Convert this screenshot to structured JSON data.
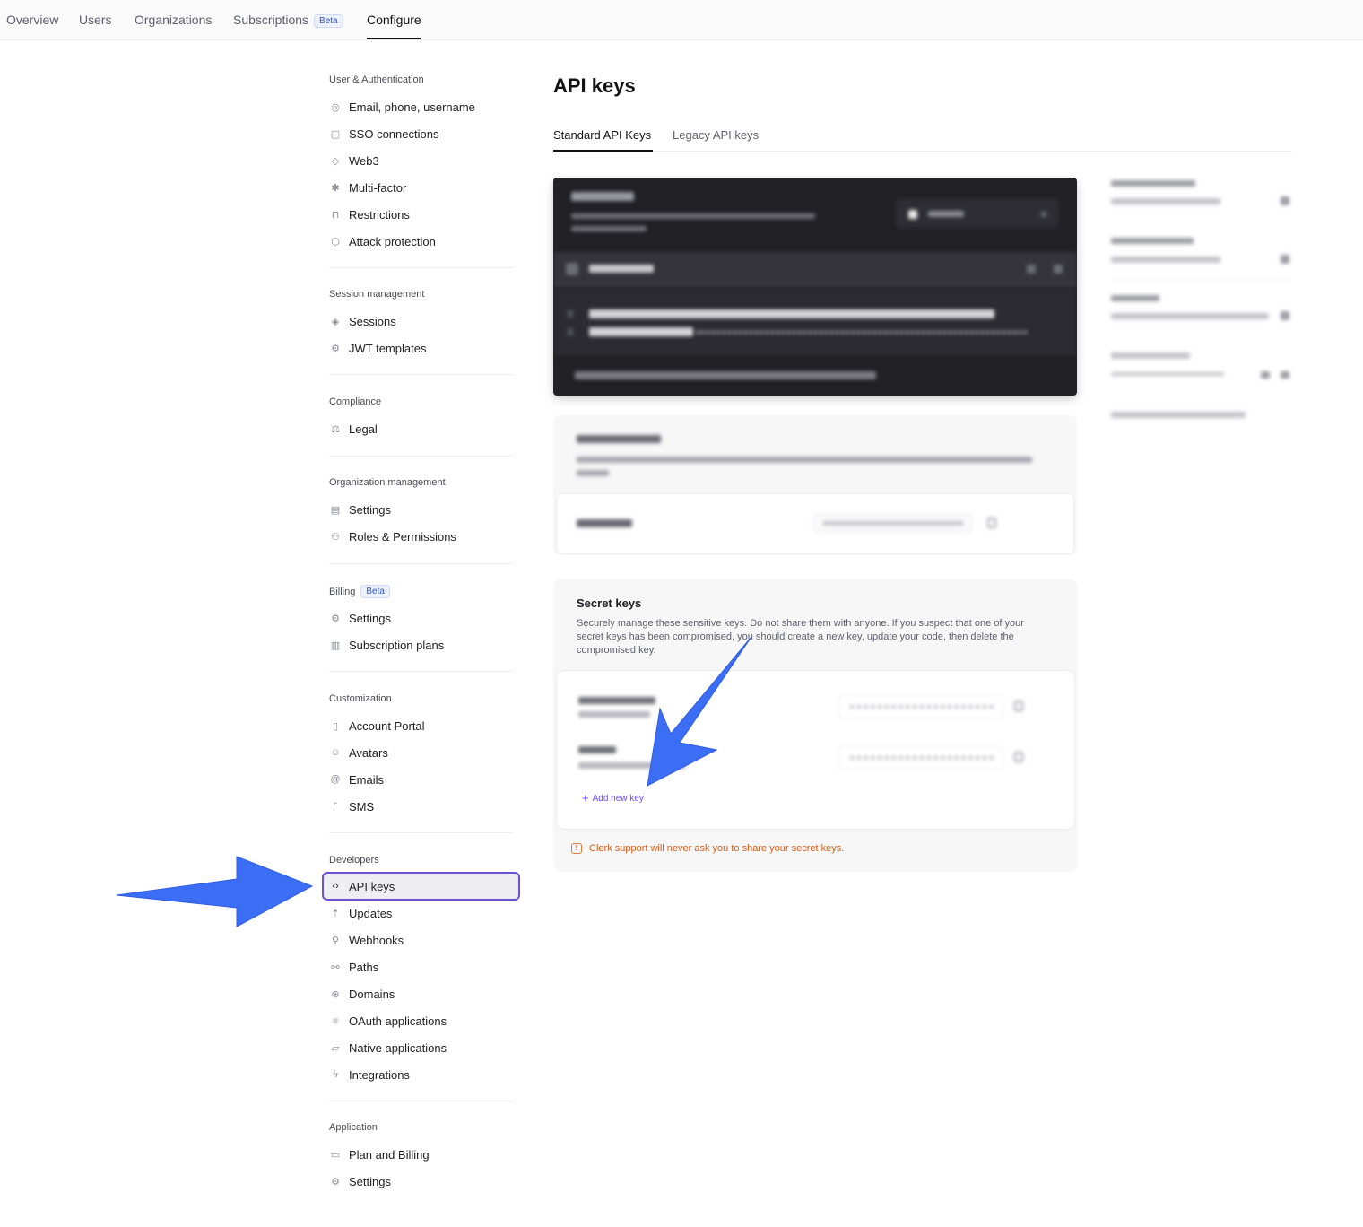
{
  "topnav": {
    "tabs": [
      {
        "label": "Overview"
      },
      {
        "label": "Users"
      },
      {
        "label": "Organizations"
      },
      {
        "label": "Subscriptions",
        "badge": "Beta"
      },
      {
        "label": "Configure",
        "active": true
      }
    ]
  },
  "sidebar": {
    "sections": [
      {
        "title": "User & Authentication",
        "items": [
          "Email, phone, username",
          "SSO connections",
          "Web3",
          "Multi-factor",
          "Restrictions",
          "Attack protection"
        ]
      },
      {
        "title": "Session management",
        "items": [
          "Sessions",
          "JWT templates"
        ]
      },
      {
        "title": "Compliance",
        "items": [
          "Legal"
        ]
      },
      {
        "title": "Organization management",
        "items": [
          "Settings",
          "Roles & Permissions"
        ]
      },
      {
        "title": "Billing",
        "badge": "Beta",
        "items": [
          "Settings",
          "Subscription plans"
        ]
      },
      {
        "title": "Customization",
        "items": [
          "Account Portal",
          "Avatars",
          "Emails",
          "SMS"
        ]
      },
      {
        "title": "Developers",
        "items": [
          "API keys",
          "Updates",
          "Webhooks",
          "Paths",
          "Domains",
          "OAuth applications",
          "Native applications",
          "Integrations"
        ]
      },
      {
        "title": "Application",
        "items": [
          "Plan and Billing",
          "Settings"
        ]
      }
    ],
    "active_item": "API keys"
  },
  "main": {
    "title": "API keys",
    "tabs": [
      {
        "label": "Standard API Keys",
        "active": true
      },
      {
        "label": "Legacy API keys"
      }
    ],
    "secret_keys": {
      "title": "Secret keys",
      "description": "Securely manage these sensitive keys. Do not share them with anyone. If you suspect that one of your secret keys has been compromised, you should create a new key, update your code, then delete the compromised key.",
      "add_new_key": "Add new key",
      "warning": "Clerk support will never ask you to share your secret keys."
    }
  },
  "colors": {
    "accent": "#6c47ff",
    "active_border": "#6b4fd6",
    "annotation_arrow": "#3b6ef5",
    "warning": "#d25c1b"
  },
  "icons": {
    "api_keys": "code-brackets-icon",
    "add_new_key": "plus-icon",
    "warning": "alert-icon"
  }
}
